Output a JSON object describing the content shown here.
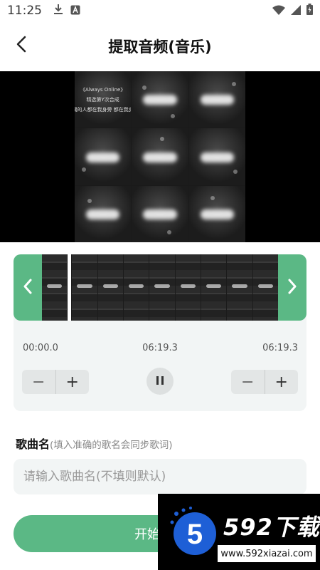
{
  "status_bar": {
    "time": "11:25",
    "icons_left": [
      "download-icon",
      "app-notification-icon"
    ],
    "icons_right": [
      "wifi-icon",
      "cellular-icon",
      "battery-icon"
    ]
  },
  "header": {
    "title": "提取音频(音乐)",
    "back_icon": "chevron-left-icon"
  },
  "video_preview": {
    "overlay_lines": [
      "《Always Online》",
      "精选第Y次合成",
      "模糊的人都在我身旁 都在我身旁"
    ]
  },
  "trim": {
    "start_time": "00:00.0",
    "current_time": "06:19.3",
    "end_time": "06:19.3",
    "minus_label": "−",
    "plus_label": "+",
    "play_state": "playing"
  },
  "song_name": {
    "label": "歌曲名",
    "hint": "(填入准确的歌名会同步歌词)",
    "placeholder": "请输入歌曲名(不填则默认)"
  },
  "actions": {
    "export_label": "开始导出"
  },
  "watermark": {
    "brand": "592下载",
    "url": "www.592xiazai.com",
    "logo_char": "5"
  },
  "colors": {
    "accent": "#5bb885",
    "panel_bg": "#f2f5f5"
  }
}
